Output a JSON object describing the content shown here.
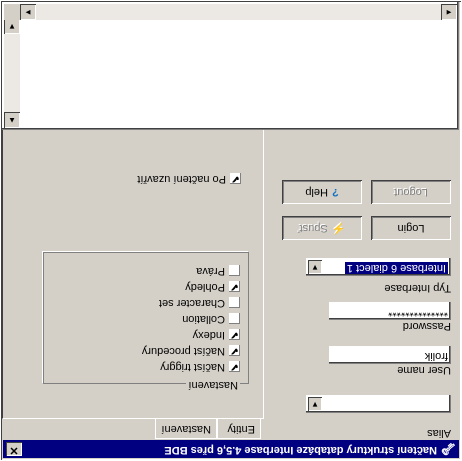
{
  "window": {
    "title": "Načtení struktury databáze Interbase 4.5,6 přes BDE",
    "close_label": "✕",
    "app_icon": "database-key-icon"
  },
  "tabs": [
    {
      "label": "Entity"
    },
    {
      "label": "Nastavení"
    }
  ],
  "settings": {
    "group_title": "Nastavení",
    "checkboxes": [
      {
        "label": "Načíst triggry",
        "checked": true
      },
      {
        "label": "Načíst procedury",
        "checked": true
      },
      {
        "label": "Indexy",
        "checked": true
      },
      {
        "label": "Collation",
        "checked": false
      },
      {
        "label": "Character set",
        "checked": false
      },
      {
        "label": "Pohledy",
        "checked": true
      },
      {
        "label": "Práva",
        "checked": false
      }
    ],
    "close_after": {
      "label": "Po načtení uzavřít",
      "checked": true
    }
  },
  "login": {
    "alias_label": "Alias",
    "alias_value": "",
    "user_label": "User name",
    "user_value": "frolik",
    "password_label": "Password",
    "password_value": "**************",
    "type_label": "Typ Interbase",
    "type_value": "Interbase 6 dialect 1",
    "login_button": "Login",
    "run_button": "Spusť",
    "logout_button": "Logout",
    "help_button": "Help"
  },
  "glyphs": {
    "check": "✔",
    "arrow_down": "▼",
    "arrow_up": "▲",
    "arrow_left": "◄",
    "arrow_right": "►",
    "help": "?",
    "run": "⚡"
  }
}
